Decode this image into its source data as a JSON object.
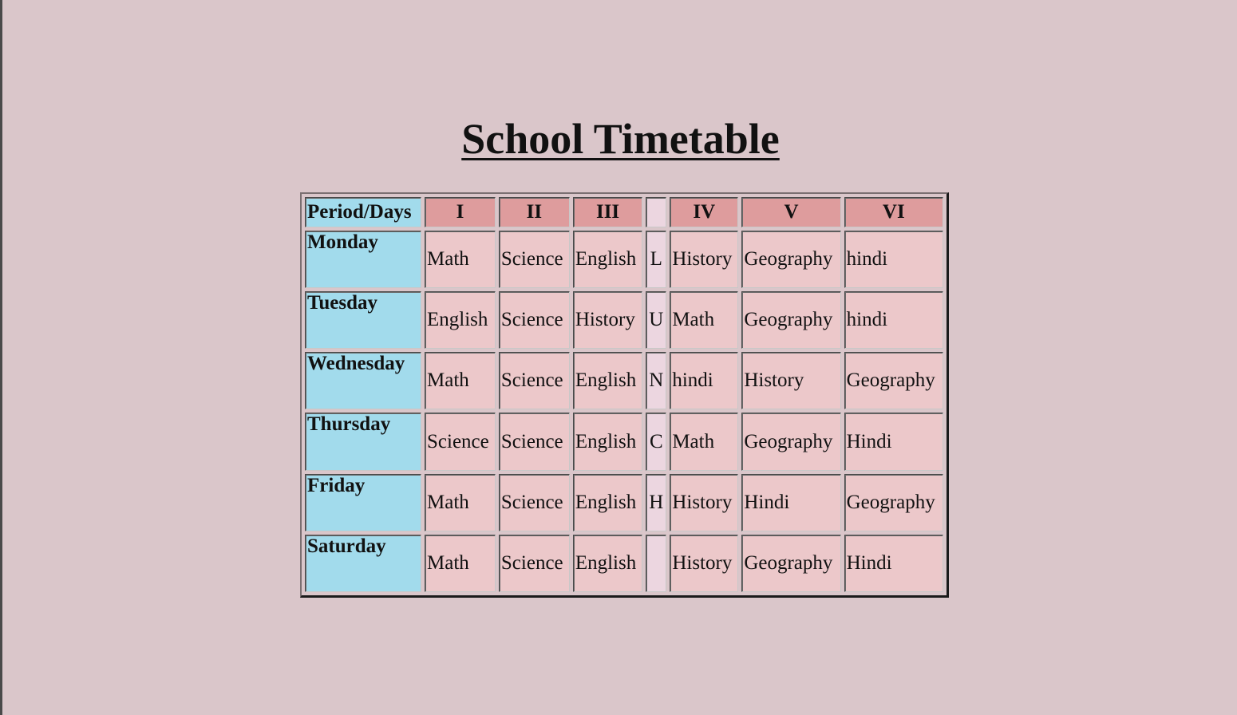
{
  "title": "School Timetable",
  "colors": {
    "page_background": "#dac6ca",
    "day_header": "#a2dbec",
    "period_header": "#de9c9d",
    "cell": "#ecc8ca",
    "lunch_column": "#ecd6e0"
  },
  "table": {
    "corner_label": "Period/Days",
    "periods": [
      "I",
      "II",
      "III",
      "",
      "IV",
      "V",
      "VI"
    ],
    "rows": [
      {
        "day": "Monday",
        "cells": [
          "Math",
          "Science",
          "English",
          "L",
          "History",
          "Geography",
          "hindi"
        ]
      },
      {
        "day": "Tuesday",
        "cells": [
          "English",
          "Science",
          "History",
          "U",
          "Math",
          "Geography",
          "hindi"
        ]
      },
      {
        "day": "Wednesday",
        "cells": [
          "Math",
          "Science",
          "English",
          "N",
          "hindi",
          "History",
          "Geography"
        ]
      },
      {
        "day": "Thursday",
        "cells": [
          "Science",
          "Science",
          "English",
          "C",
          "Math",
          "Geography",
          "Hindi"
        ]
      },
      {
        "day": "Friday",
        "cells": [
          "Math",
          "Science",
          "English",
          "H",
          "History",
          "Hindi",
          "Geography"
        ]
      },
      {
        "day": "Saturday",
        "cells": [
          "Math",
          "Science",
          "English",
          "",
          "History",
          "Geography",
          "Hindi"
        ]
      }
    ]
  }
}
